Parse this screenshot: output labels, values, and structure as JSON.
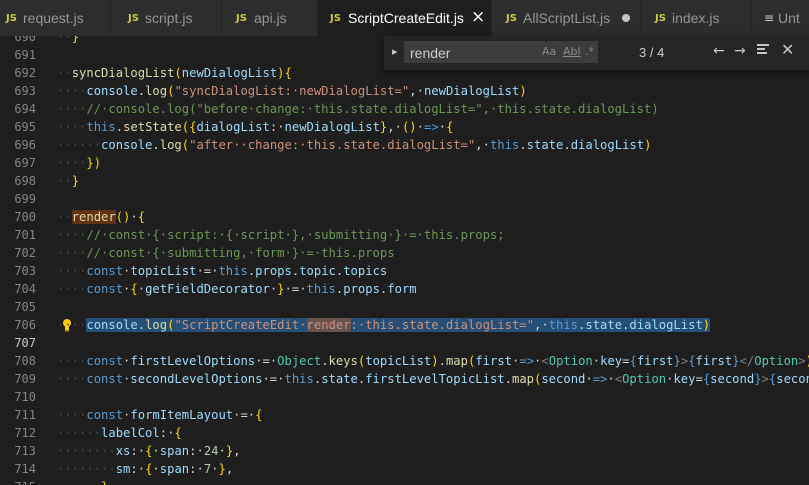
{
  "tabs": [
    {
      "icon": "JS",
      "label": "request.js"
    },
    {
      "icon": "JS",
      "label": "script.js"
    },
    {
      "icon": "JS",
      "label": "api.js"
    },
    {
      "icon": "JS",
      "label": "ScriptCreateEdit.js",
      "active": true,
      "close": "×"
    },
    {
      "icon": "JS",
      "label": "AllScriptList.js",
      "dirty": true
    },
    {
      "icon": "JS",
      "label": "index.js"
    },
    {
      "icon": "≡",
      "label": "Unt"
    }
  ],
  "find_widget": {
    "toggle_icon": "chevron-right-icon",
    "query": "render",
    "match_case": "Aa",
    "whole_word": "Abl",
    "regex": ".*",
    "count": "3 / 4",
    "prev_icon": "arrow-up-icon",
    "next_icon": "arrow-down-icon",
    "selection_icon": "find-in-selection-icon",
    "close_icon": "close-icon"
  },
  "editor": {
    "current_line": "707",
    "lightbulb_icon": "lightbulb-icon",
    "lines": [
      {
        "n": "690",
        "tokens": [
          [
            "ws",
            "··"
          ],
          [
            "br",
            "}"
          ]
        ]
      },
      {
        "n": "691",
        "tokens": []
      },
      {
        "n": "692",
        "tokens": [
          [
            "ws",
            "··"
          ],
          [
            "fn",
            "syncDialogList"
          ],
          [
            "br",
            "("
          ],
          [
            "vr",
            "newDialogList"
          ],
          [
            "br",
            ")"
          ],
          [
            "br",
            "{"
          ]
        ]
      },
      {
        "n": "693",
        "tokens": [
          [
            "ws",
            "····"
          ],
          [
            "vr",
            "console"
          ],
          [
            "",
            "."
          ],
          [
            "fn",
            "log"
          ],
          [
            "br",
            "("
          ],
          [
            "st",
            "\"syncDialogList:·newDialogList=\""
          ],
          [
            "",
            ",·"
          ],
          [
            "vr",
            "newDialogList"
          ],
          [
            "br",
            ")"
          ]
        ]
      },
      {
        "n": "694",
        "tokens": [
          [
            "ws",
            "····"
          ],
          [
            "cm",
            "//·console.log(\"before·change:·this.state.dialogList=\",·this.state.dialogList)"
          ]
        ]
      },
      {
        "n": "695",
        "tokens": [
          [
            "ws",
            "····"
          ],
          [
            "kw",
            "this"
          ],
          [
            "",
            "."
          ],
          [
            "fn",
            "setState"
          ],
          [
            "br",
            "("
          ],
          [
            "br",
            "{"
          ],
          [
            "vr",
            "dialogList"
          ],
          [
            "",
            ":·"
          ],
          [
            "vr",
            "newDialogList"
          ],
          [
            "br",
            "}"
          ],
          [
            "",
            ",·"
          ],
          [
            "br",
            "()"
          ],
          [
            "",
            "·"
          ],
          [
            "kw",
            "=>"
          ],
          [
            "",
            "·"
          ],
          [
            "br",
            "{"
          ]
        ]
      },
      {
        "n": "696",
        "tokens": [
          [
            "ws",
            "······"
          ],
          [
            "vr",
            "console"
          ],
          [
            "",
            "."
          ],
          [
            "fn",
            "log"
          ],
          [
            "br",
            "("
          ],
          [
            "st",
            "\"after··change:·this.state.dialogList=\""
          ],
          [
            "",
            ",·"
          ],
          [
            "kw",
            "this"
          ],
          [
            "",
            "."
          ],
          [
            "vr",
            "state"
          ],
          [
            "",
            "."
          ],
          [
            "vr",
            "dialogList"
          ],
          [
            "br",
            ")"
          ]
        ]
      },
      {
        "n": "697",
        "tokens": [
          [
            "ws",
            "····"
          ],
          [
            "br",
            "})"
          ]
        ]
      },
      {
        "n": "698",
        "tokens": [
          [
            "ws",
            "··"
          ],
          [
            "br",
            "}"
          ]
        ]
      },
      {
        "n": "699",
        "tokens": []
      },
      {
        "n": "700",
        "tokens": [
          [
            "ws",
            "··"
          ],
          [
            "fn hl-find",
            "render"
          ],
          [
            "br",
            "()"
          ],
          [
            "",
            "·"
          ],
          [
            "br",
            "{"
          ]
        ]
      },
      {
        "n": "701",
        "tokens": [
          [
            "ws",
            "····"
          ],
          [
            "cm",
            "//·const·{·script:·{·script·},·submitting·}·=·this.props;"
          ]
        ]
      },
      {
        "n": "702",
        "tokens": [
          [
            "ws",
            "····"
          ],
          [
            "cm",
            "//·const·{·submitting,·form·}·=·this.props"
          ]
        ]
      },
      {
        "n": "703",
        "tokens": [
          [
            "ws",
            "····"
          ],
          [
            "kw",
            "const"
          ],
          [
            "",
            "·"
          ],
          [
            "vr",
            "topicList"
          ],
          [
            "",
            "·=·"
          ],
          [
            "kw",
            "this"
          ],
          [
            "",
            "."
          ],
          [
            "vr",
            "props"
          ],
          [
            "",
            "."
          ],
          [
            "vr",
            "topic"
          ],
          [
            "",
            "."
          ],
          [
            "vr",
            "topics"
          ]
        ]
      },
      {
        "n": "704",
        "tokens": [
          [
            "ws",
            "····"
          ],
          [
            "kw",
            "const"
          ],
          [
            "",
            "·"
          ],
          [
            "br",
            "{"
          ],
          [
            "",
            "·"
          ],
          [
            "vr",
            "getFieldDecorator"
          ],
          [
            "",
            "·"
          ],
          [
            "br",
            "}"
          ],
          [
            "",
            "·=·"
          ],
          [
            "kw",
            "this"
          ],
          [
            "",
            "."
          ],
          [
            "vr",
            "props"
          ],
          [
            "",
            "."
          ],
          [
            "vr",
            "form"
          ]
        ]
      },
      {
        "n": "705",
        "tokens": []
      },
      {
        "n": "706",
        "selected": true,
        "tokens": [
          [
            "ws",
            "····"
          ],
          [
            "vr",
            "console"
          ],
          [
            "",
            "."
          ],
          [
            "fn",
            "log"
          ],
          [
            "br",
            "("
          ],
          [
            "st",
            "\"ScriptCreateEdit·"
          ],
          [
            "st hl-find",
            "render"
          ],
          [
            "st",
            ":·this.state.dialogList=\""
          ],
          [
            "",
            ",·"
          ],
          [
            "kw",
            "this"
          ],
          [
            "",
            "."
          ],
          [
            "vr",
            "state"
          ],
          [
            "",
            "."
          ],
          [
            "vr",
            "dialogList"
          ],
          [
            "br",
            ")"
          ]
        ]
      },
      {
        "n": "707",
        "tokens": []
      },
      {
        "n": "708",
        "tokens": [
          [
            "ws",
            "····"
          ],
          [
            "kw",
            "const"
          ],
          [
            "",
            "·"
          ],
          [
            "vr",
            "firstLevelOptions"
          ],
          [
            "",
            "·=·"
          ],
          [
            "ty",
            "Object"
          ],
          [
            "",
            "."
          ],
          [
            "fn",
            "keys"
          ],
          [
            "br",
            "("
          ],
          [
            "vr",
            "topicList"
          ],
          [
            "br",
            ")"
          ],
          [
            "",
            "."
          ],
          [
            "fn",
            "map"
          ],
          [
            "br",
            "("
          ],
          [
            "vr",
            "first"
          ],
          [
            "",
            "·"
          ],
          [
            "kw",
            "=>"
          ],
          [
            "",
            "·"
          ],
          [
            "tp",
            "<"
          ],
          [
            "tag",
            "Option"
          ],
          [
            "",
            "·"
          ],
          [
            "vr",
            "key"
          ],
          [
            "",
            "="
          ],
          [
            "kw",
            "{"
          ],
          [
            "vr",
            "first"
          ],
          [
            "kw",
            "}"
          ],
          [
            "tp",
            ">"
          ],
          [
            "kw",
            "{"
          ],
          [
            "vr",
            "first"
          ],
          [
            "kw",
            "}"
          ],
          [
            "tp",
            "</"
          ],
          [
            "tag",
            "Option"
          ],
          [
            "tp",
            ">"
          ],
          [
            "br",
            ")"
          ],
          [
            "",
            ";"
          ]
        ]
      },
      {
        "n": "709",
        "tokens": [
          [
            "ws",
            "····"
          ],
          [
            "kw",
            "const"
          ],
          [
            "",
            "·"
          ],
          [
            "vr",
            "secondLevelOptions"
          ],
          [
            "",
            "·=·"
          ],
          [
            "kw",
            "this"
          ],
          [
            "",
            "."
          ],
          [
            "vr",
            "state"
          ],
          [
            "",
            "."
          ],
          [
            "vr",
            "firstLevelTopicList"
          ],
          [
            "",
            "."
          ],
          [
            "fn",
            "map"
          ],
          [
            "br",
            "("
          ],
          [
            "vr",
            "second"
          ],
          [
            "",
            "·"
          ],
          [
            "kw",
            "=>"
          ],
          [
            "",
            "·"
          ],
          [
            "tp",
            "<"
          ],
          [
            "tag",
            "Option"
          ],
          [
            "",
            "·"
          ],
          [
            "vr",
            "key"
          ],
          [
            "",
            "="
          ],
          [
            "kw",
            "{"
          ],
          [
            "vr",
            "second"
          ],
          [
            "kw",
            "}"
          ],
          [
            "tp",
            ">"
          ],
          [
            "kw",
            "{"
          ],
          [
            "vr",
            "second"
          ]
        ]
      },
      {
        "n": "710",
        "tokens": []
      },
      {
        "n": "711",
        "tokens": [
          [
            "ws",
            "····"
          ],
          [
            "kw",
            "const"
          ],
          [
            "",
            "·"
          ],
          [
            "vr",
            "formItemLayout"
          ],
          [
            "",
            "·=·"
          ],
          [
            "br",
            "{"
          ]
        ]
      },
      {
        "n": "712",
        "tokens": [
          [
            "ws",
            "······"
          ],
          [
            "vr",
            "labelCol"
          ],
          [
            "",
            ":·"
          ],
          [
            "br",
            "{"
          ]
        ]
      },
      {
        "n": "713",
        "tokens": [
          [
            "ws",
            "········"
          ],
          [
            "vr",
            "xs"
          ],
          [
            "",
            ":·"
          ],
          [
            "br",
            "{"
          ],
          [
            "",
            "·"
          ],
          [
            "vr",
            "span"
          ],
          [
            "",
            ":·"
          ],
          [
            "nm",
            "24"
          ],
          [
            "",
            "·"
          ],
          [
            "br",
            "}"
          ],
          [
            "",
            ","
          ]
        ]
      },
      {
        "n": "714",
        "tokens": [
          [
            "ws",
            "········"
          ],
          [
            "vr",
            "sm"
          ],
          [
            "",
            ":·"
          ],
          [
            "br",
            "{"
          ],
          [
            "",
            "·"
          ],
          [
            "vr",
            "span"
          ],
          [
            "",
            ":·"
          ],
          [
            "nm",
            "7"
          ],
          [
            "",
            "·"
          ],
          [
            "br",
            "}"
          ],
          [
            "",
            ","
          ]
        ]
      },
      {
        "n": "715",
        "tokens": [
          [
            "ws",
            "······"
          ],
          [
            "br",
            "},"
          ]
        ]
      }
    ]
  }
}
